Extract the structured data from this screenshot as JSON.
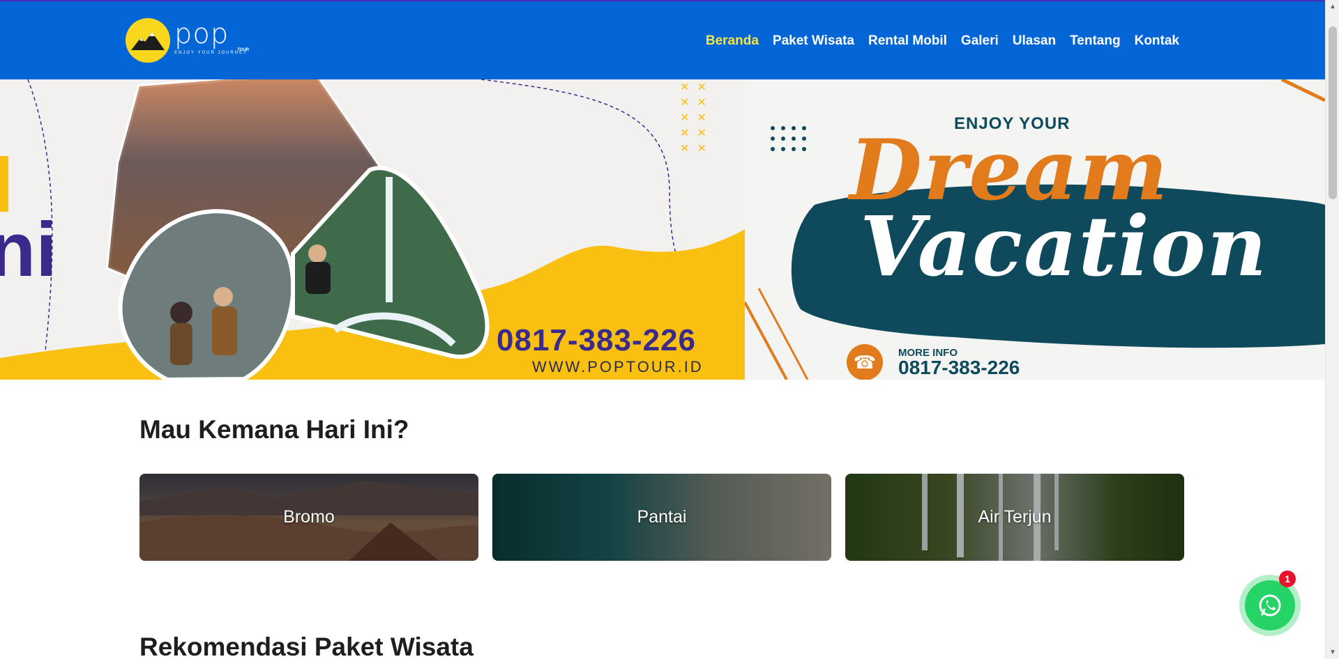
{
  "header": {
    "logo_word": "pop",
    "logo_tour": "TOUR",
    "logo_tagline": "ENJOY YOUR JOURNEY",
    "nav": [
      {
        "label": "Beranda",
        "active": true
      },
      {
        "label": "Paket Wisata",
        "active": false
      },
      {
        "label": "Rental Mobil",
        "active": false
      },
      {
        "label": "Galeri",
        "active": false
      },
      {
        "label": "Ulasan",
        "active": false
      },
      {
        "label": "Tentang",
        "active": false
      },
      {
        "label": "Kontak",
        "active": false
      }
    ]
  },
  "hero": {
    "left_slide": {
      "partial_text": "ni",
      "phone": "0817-383-226",
      "website": "WWW.POPTOUR.ID"
    },
    "right_slide": {
      "enjoy": "ENJOY YOUR",
      "dream": "Dream",
      "vacation": "Vacation",
      "more_info": "MORE INFO",
      "phone": "0817-383-226"
    }
  },
  "destinations": {
    "title": "Mau Kemana Hari Ini?",
    "cards": [
      {
        "label": "Bromo"
      },
      {
        "label": "Pantai"
      },
      {
        "label": "Air Terjun"
      }
    ]
  },
  "packages": {
    "title": "Rekomendasi Paket Wisata"
  },
  "whatsapp": {
    "badge_count": "1"
  },
  "colors": {
    "header_bg": "#0465d6",
    "nav_active": "#f9e43b",
    "whatsapp": "#25d366",
    "badge": "#e8132b"
  }
}
